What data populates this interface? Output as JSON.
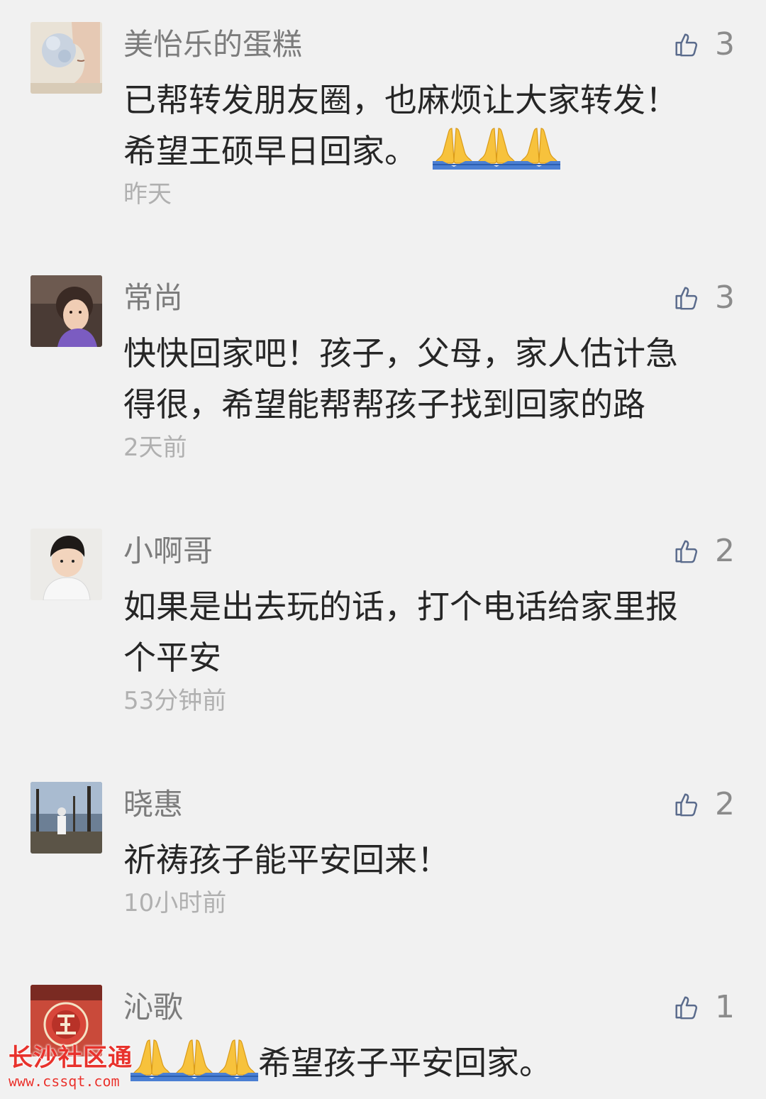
{
  "comments": [
    {
      "name": "美怡乐的蛋糕",
      "likes": "3",
      "text_lines": [
        "已帮转发朋友圈，也麻烦让大家转发！",
        "希望王硕早日回家。"
      ],
      "trailing_emoji": [
        "folded-hands",
        "folded-hands",
        "folded-hands"
      ],
      "time": "昨天"
    },
    {
      "name": "常尚",
      "likes": "3",
      "text_lines": [
        "快快回家吧！孩子，父母，家人估计急",
        "得很，希望能帮帮孩子找到回家的路"
      ],
      "time": "2天前"
    },
    {
      "name": "小啊哥",
      "likes": "2",
      "text_lines": [
        "如果是出去玩的话，打个电话给家里报",
        "个平安"
      ],
      "time": "53分钟前"
    },
    {
      "name": "晓惠",
      "likes": "2",
      "text_lines": [
        "祈祷孩子能平安回来！"
      ],
      "time": "10小时前"
    },
    {
      "name": "沁歌",
      "likes": "1",
      "leading_emoji": [
        "folded-hands",
        "folded-hands",
        "folded-hands"
      ],
      "text_lines": [
        "希望孩子平安回家。"
      ]
    }
  ],
  "icons": {
    "like": "thumbs-up-icon",
    "emoji": "folded-hands-emoji"
  },
  "watermark": {
    "title": "长沙社区通",
    "url": "www.cssqt.com"
  },
  "colors": {
    "background": "#f1f1f1",
    "name": "#7c7c7c",
    "text": "#262626",
    "time": "#b0b0b0",
    "like_icon": "#5a6b8c",
    "watermark": "#e8322c"
  }
}
